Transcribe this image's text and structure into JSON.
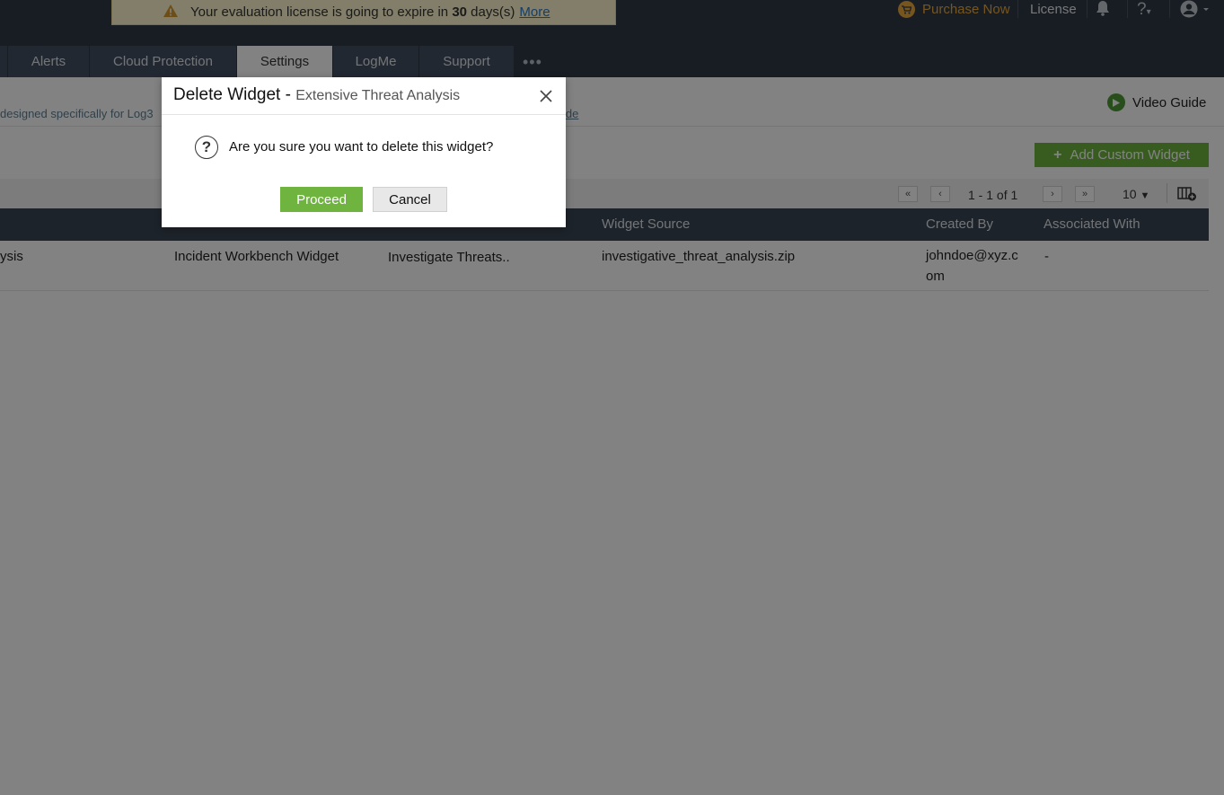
{
  "banner": {
    "message_prefix": "Your evaluation license is going to expire in",
    "days": "30",
    "message_suffix": "days(s)",
    "more_link": "More"
  },
  "header": {
    "purchase_label": "Purchase Now",
    "license_label": "License",
    "help_label": "?"
  },
  "tabs": [
    {
      "label": "Alerts"
    },
    {
      "label": "Cloud Protection"
    },
    {
      "label": "Settings",
      "active": true
    },
    {
      "label": "LogMe"
    },
    {
      "label": "Support"
    }
  ],
  "tab_more": "•••",
  "page": {
    "description": "designed specifically for Log3",
    "description_link": "ide",
    "video_guide": "Video Guide",
    "add_button": "Add Custom Widget"
  },
  "pager": {
    "range": "1 - 1 of 1",
    "per_page": "10"
  },
  "table": {
    "columns": [
      "Widget Source",
      "Created By",
      "Associated With"
    ],
    "rows": [
      {
        "name": "ysis",
        "type": "Incident Workbench Widget",
        "description": "Investigate Threats..",
        "source": "investigative_threat_analysis.zip",
        "created_by": "johndoe@xyz.com",
        "associated_with": "-"
      }
    ]
  },
  "modal": {
    "title": "Delete Widget - ",
    "subtitle": "Extensive Threat Analysis",
    "question": "Are you sure you want to delete this widget?",
    "proceed_label": "Proceed",
    "cancel_label": "Cancel"
  },
  "colors": {
    "header_bg": "#2f3945",
    "accent_green": "#6fb43f",
    "purchase_orange": "#e7a83c"
  }
}
